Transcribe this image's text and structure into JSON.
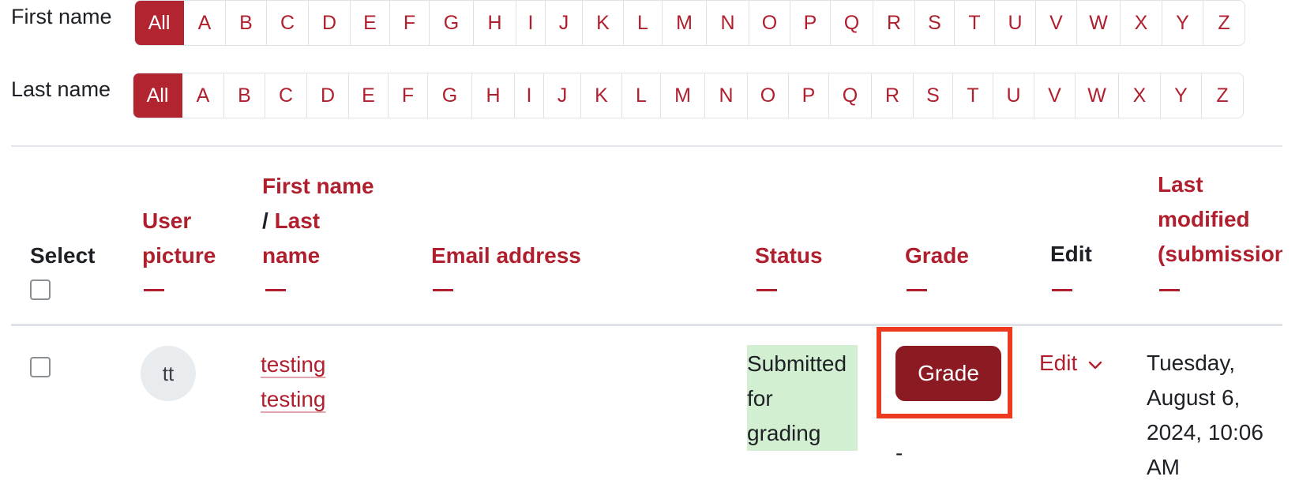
{
  "filters": {
    "first_name_label": "First name",
    "last_name_label": "Last name",
    "letters": [
      "All",
      "A",
      "B",
      "C",
      "D",
      "E",
      "F",
      "G",
      "H",
      "I",
      "J",
      "K",
      "L",
      "M",
      "N",
      "O",
      "P",
      "Q",
      "R",
      "S",
      "T",
      "U",
      "V",
      "W",
      "X",
      "Y",
      "Z"
    ],
    "active_letter": "All"
  },
  "table": {
    "headers": {
      "select": "Select",
      "user_picture_line1": "User",
      "user_picture_line2": "picture",
      "first_name": "First name",
      "slash": "/",
      "last_name_line1": "Last",
      "last_name_line2": "name",
      "email": "Email address",
      "status": "Status",
      "grade": "Grade",
      "edit": "Edit",
      "modified_line1": "Last",
      "modified_line2": "modified",
      "modified_line3": "(submission)"
    },
    "row": {
      "avatar_initials": "tt",
      "first_name": "testing",
      "last_name": "testing",
      "status_line1": "Submitted",
      "status_line2": "for",
      "status_line3": "grading",
      "grade_button": "Grade",
      "grade_value": "-",
      "edit_label": "Edit",
      "modified_line1": "Tuesday,",
      "modified_line2": "August 6,",
      "modified_line3": "2024, 10:06",
      "modified_line4": "AM"
    }
  },
  "colors": {
    "accent": "#b01f2e",
    "grade_button": "#8b1a22",
    "status_bg": "#d3efd1",
    "highlight": "#ee3a1e"
  },
  "icons": {
    "edit_menu": "chevron-down-icon"
  }
}
